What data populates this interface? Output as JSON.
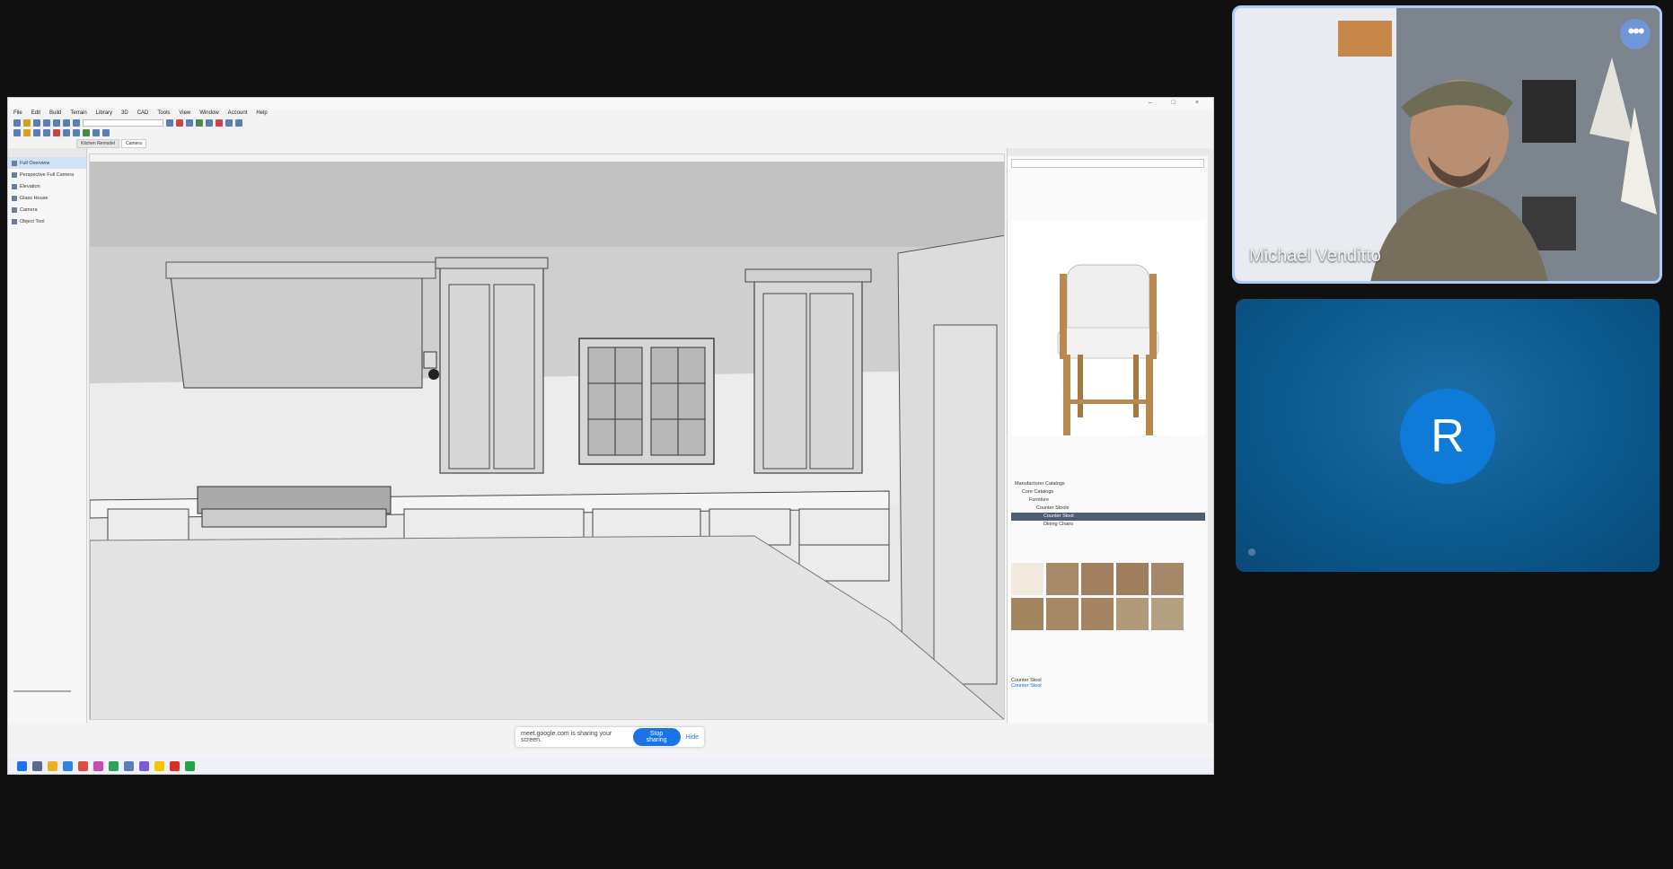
{
  "app": {
    "menus": [
      "File",
      "Edit",
      "Build",
      "Terrain",
      "Library",
      "3D",
      "CAD",
      "Tools",
      "View",
      "Window",
      "Account",
      "Help"
    ],
    "tabs": [
      {
        "label": "Kitchen Remodel",
        "active": false
      },
      {
        "label": "Camera",
        "active": true
      }
    ],
    "left_pane": {
      "items": [
        "Full Overview",
        "Perspective Full Camera",
        "Elevation",
        "Glass House",
        "Camera",
        "Object Tool"
      ]
    },
    "right_pane": {
      "tree": [
        "Manufacturer Catalogs",
        "Core Catalogs",
        "Furniture",
        "Counter Stools",
        "Counter Stool",
        "Dining Chairs"
      ],
      "details_title": "Counter Stool",
      "details_link": "Counter Stool"
    },
    "share_banner": {
      "text": "meet.google.com is sharing your screen.",
      "stop_label": "Stop sharing",
      "hide_label": "Hide"
    }
  },
  "participants": [
    {
      "name": "Michael Venditto",
      "video_on": true
    },
    {
      "name": "",
      "initial": "R",
      "video_on": false
    }
  ],
  "colors": {
    "accent": "#1a73e8",
    "tile_r_bg": "#0b5a8f",
    "avatar_r": "#0f7bd8",
    "active_speaker_border": "#aecbfa",
    "swatches": [
      "#f2e9df",
      "#a88a6a",
      "#a08060",
      "#9e7e5d",
      "#a58868",
      "#a38560",
      "#a78866",
      "#a48463",
      "#b09a7a",
      "#b3a080"
    ]
  }
}
